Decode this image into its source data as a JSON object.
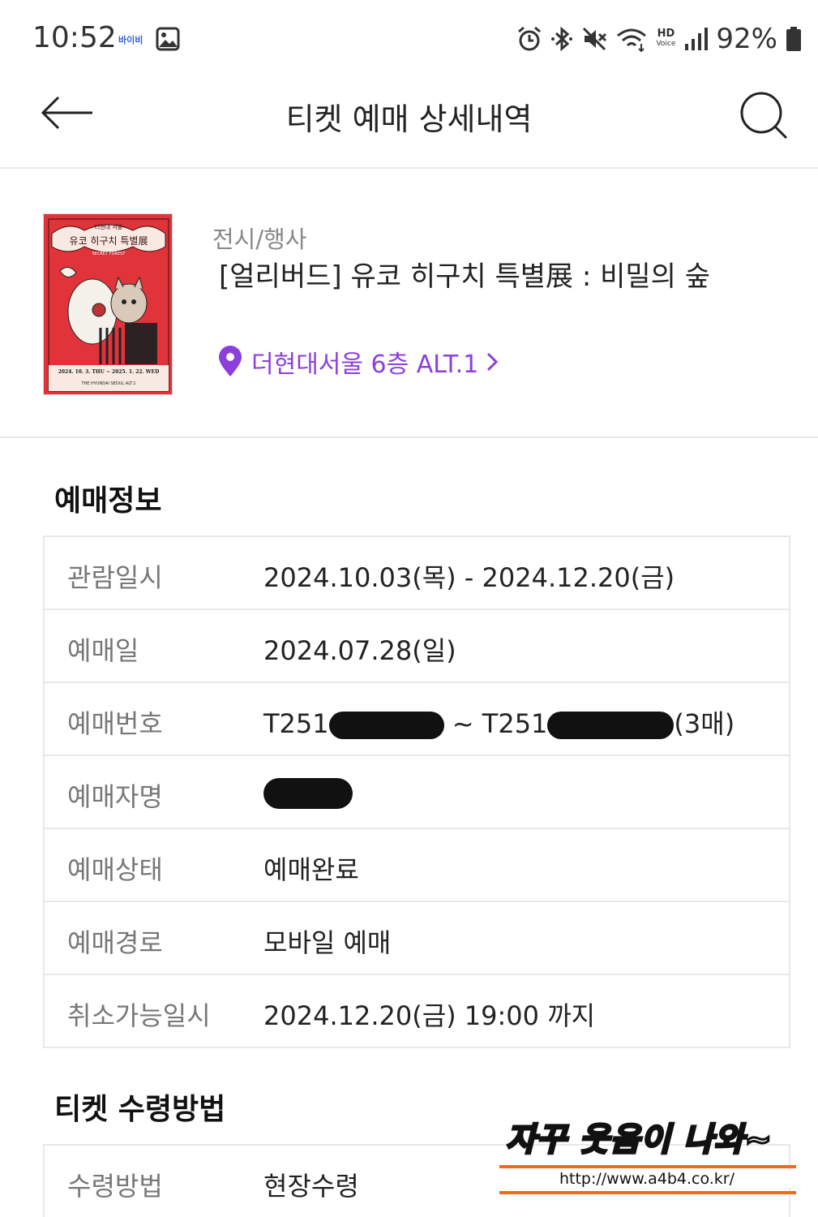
{
  "status_bar": {
    "time": "10:52",
    "app_badge": "바이비",
    "battery": "92%",
    "icons": [
      "gallery-icon",
      "alarm-icon",
      "bluetooth-icon",
      "mute-icon",
      "wifi-icon",
      "hd-voice-icon",
      "signal-icon",
      "battery-icon"
    ],
    "hd_label": "HD",
    "voice_label": "Voice"
  },
  "header": {
    "title": "티켓 예매 상세내역",
    "back_icon": "back-arrow-icon",
    "search_icon": "search-icon"
  },
  "product": {
    "category": "전시/행사",
    "title": "[얼리버드]  유코 히구치 특별展 : 비밀의 숲",
    "venue": "더현대서울 6층 ALT.1",
    "poster": {
      "top_line": "더현대 서울",
      "title": "유코 히구치 특별展",
      "subtitle": "SECRET FOREST",
      "dates": "2024. 10. 3. THU ~ 2025. 1. 22. WED",
      "venue": "THE HYUNDAI SEOUL ALT.1"
    }
  },
  "reservation": {
    "section_title": "예매정보",
    "rows": [
      {
        "label": "관람일시",
        "value": "2024.10.03(목) - 2024.12.20(금)"
      },
      {
        "label": "예매일",
        "value": "2024.07.28(일)"
      },
      {
        "label": "예매번호",
        "prefix1": "T251",
        "sep": " ~ ",
        "prefix2": "T251",
        "suffix": "(3매)"
      },
      {
        "label": "예매자명",
        "value": ""
      },
      {
        "label": "예매상태",
        "value": "예매완료"
      },
      {
        "label": "예매경로",
        "value": "모바일 예매"
      },
      {
        "label": "취소가능일시",
        "value": "2024.12.20(금) 19:00 까지"
      }
    ]
  },
  "delivery": {
    "section_title": "티켓 수령방법",
    "rows": [
      {
        "label": "수령방법",
        "value": "현장수령"
      }
    ]
  },
  "watermark": {
    "text": "자꾸 웃음이 나와~",
    "url": "http://www.a4b4.co.kr/"
  },
  "colors": {
    "accent_purple": "#8b3fdc",
    "watermark_orange": "#ee6a1f",
    "poster_red": "#e0333a"
  }
}
